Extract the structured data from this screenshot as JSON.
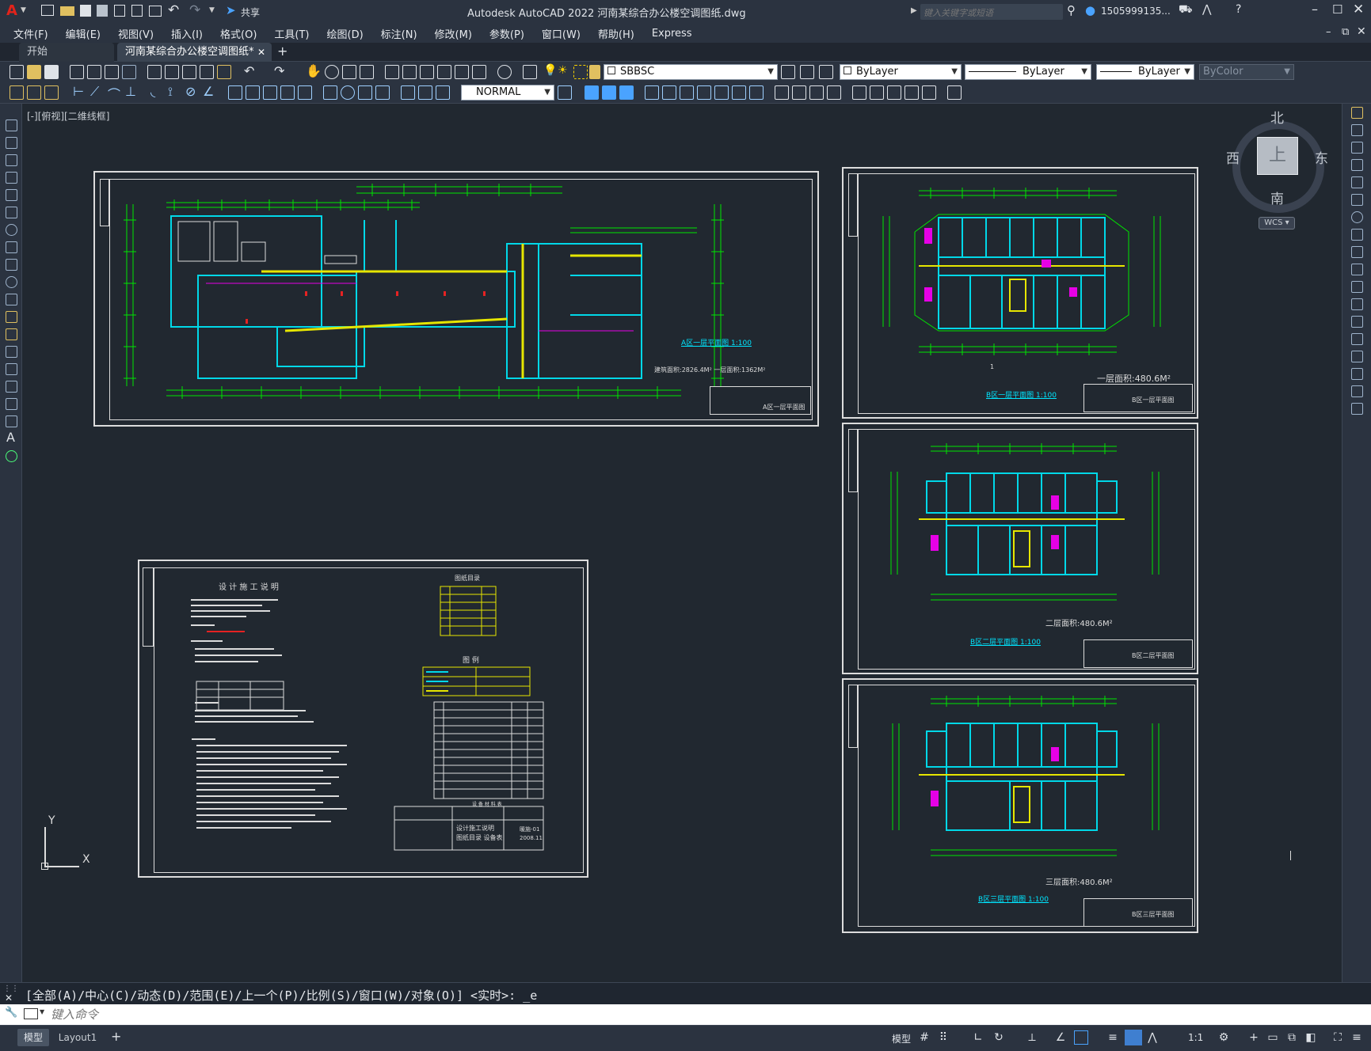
{
  "app": {
    "title": "Autodesk AutoCAD 2022    河南某综合办公楼空调图纸.dwg",
    "share_label": "共享",
    "search_placeholder": "键入关键字或短语",
    "user": "1505999135...",
    "logo": "A"
  },
  "menu": [
    "文件(F)",
    "编辑(E)",
    "视图(V)",
    "插入(I)",
    "格式(O)",
    "工具(T)",
    "绘图(D)",
    "标注(N)",
    "修改(M)",
    "参数(P)",
    "窗口(W)",
    "帮助(H)",
    "Express"
  ],
  "tabs": [
    {
      "label": "开始",
      "active": false
    },
    {
      "label": "河南某综合办公楼空调图纸*",
      "active": true
    }
  ],
  "toolbar": {
    "layer": "SBBSC",
    "color": "ByLayer",
    "linetype": "ByLayer",
    "lineweight": "ByLayer",
    "plotstyle": "ByColor",
    "dimstyle": "NORMAL"
  },
  "viewport_label": "[-][俯视][二维线框]",
  "viewcube": {
    "north": "北",
    "south": "南",
    "east": "东",
    "west": "西",
    "face": "上",
    "wcs": "WCS"
  },
  "drawings": {
    "main_plan": {
      "title": "A区一层平面图 1:100",
      "area": "建筑面积:2826.4M²   一层面积:1362M²",
      "titleblock": "A区一层平面图"
    },
    "sheet_b1": {
      "title": "B区一层平面图 1:100",
      "area": "一层面积:480.6M²",
      "titleblock": "B区一层平面图"
    },
    "sheet_b2": {
      "title": "B区二层平面图 1:100",
      "area": "二层面积:480.6M²",
      "titleblock": "B区二层平面图"
    },
    "sheet_b3": {
      "title": "B区三层平面图 1:100",
      "area": "三层面积:480.6M²",
      "titleblock": "B区三层平面图"
    },
    "notes": {
      "heading": "设 计 施 工 说 明",
      "index_title": "图纸目录",
      "legend_title": "图   例",
      "titleblock_a": "设计施工说明",
      "titleblock_b": "图纸目录   设备表",
      "sheet_no": "暖施-01",
      "date": "2008.11",
      "materials": "设 备 材 料 表"
    }
  },
  "ucs": {
    "x": "X",
    "y": "Y"
  },
  "command": {
    "history": "[全部(A)/中心(C)/动态(D)/范围(E)/上一个(P)/比例(S)/窗口(W)/对象(O)] <实时>: _e",
    "placeholder": "键入命令"
  },
  "status": {
    "layout_tabs": [
      "模型",
      "Layout1"
    ],
    "model_label": "模型",
    "scale": "1:1"
  },
  "colors": {
    "bg": "#212830",
    "green": "#00e600",
    "cyan": "#00d8e8",
    "yellow": "#e6e600",
    "magenta": "#e600e6",
    "white": "#dcdcdc"
  }
}
